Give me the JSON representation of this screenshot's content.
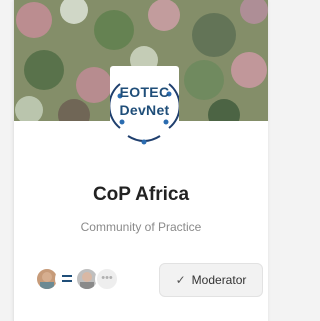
{
  "community": {
    "name": "CoP Africa",
    "subtitle": "Community of Practice"
  },
  "logo": {
    "line1": "EOTEC",
    "line2": "DevNet"
  },
  "members": {
    "more_label": "•••"
  },
  "moderator_button": {
    "icon": "check-icon",
    "label": "Moderator"
  },
  "colors": {
    "logo_text": "#1f4e79",
    "logo_ring": "#1f3f6e",
    "logo_dot": "#2b6cb0"
  }
}
